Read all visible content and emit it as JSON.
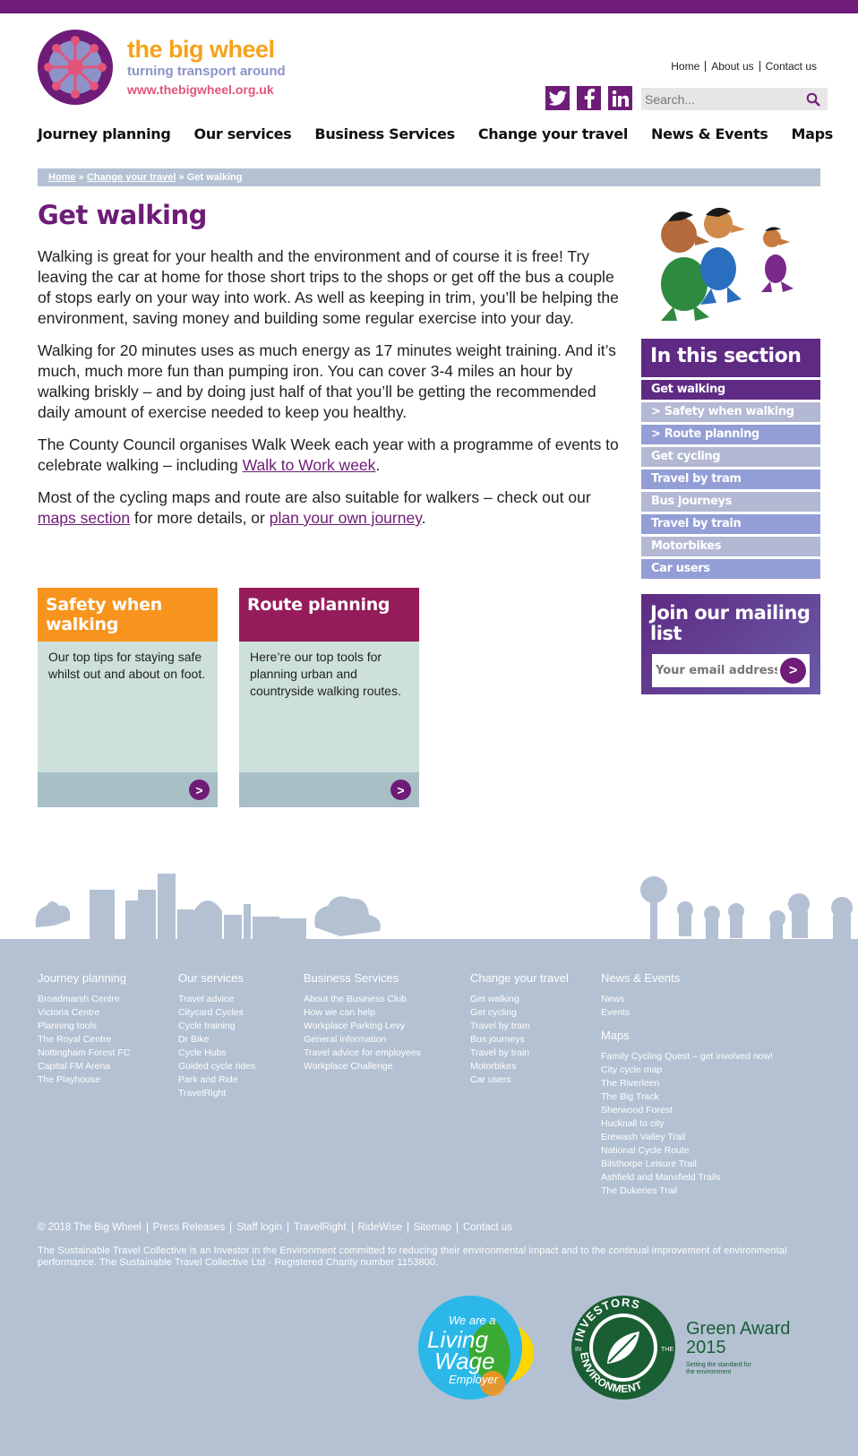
{
  "logo": {
    "title": "the big wheel",
    "subtitle": "turning transport around",
    "url": "www.thebigwheel.org.uk"
  },
  "toplinks": [
    "Home",
    "About us",
    "Contact us"
  ],
  "social": [
    {
      "icon": "twitter-icon",
      "glyph": "t"
    },
    {
      "icon": "facebook-icon",
      "glyph": "f"
    },
    {
      "icon": "linkedin-icon",
      "glyph": "in"
    }
  ],
  "search": {
    "placeholder": "Search..."
  },
  "nav": [
    "Journey planning",
    "Our services",
    "Business Services",
    "Change your travel",
    "News & Events",
    "Maps"
  ],
  "breadcrumb": {
    "home": "Home",
    "sep": "»",
    "parent": "Change your travel",
    "current": "Get walking"
  },
  "main": {
    "title": "Get walking",
    "p1": "Walking is great for your health and the environment and of course it is free!  Try leaving the car at home for those short trips to the shops or get off the bus a couple of stops early on your way into work. As well as keeping in trim, you’ll be helping the environment, saving money and building some regular exercise into your day.",
    "p2": "Walking for 20 minutes  uses as much energy as 17 minutes  weight training. And it’s much, much  more fun than pumping iron. You can  cover 3-4 miles an hour by walking  briskly – and by doing just half of that  you’ll be getting the recommended  daily amount of exercise needed to  keep you healthy.",
    "p3_before": "The County Council organises Walk Week each year with a programme of events to celebrate walking – including ",
    "p3_link": "Walk to Work week",
    "p3_after": ".",
    "p4_before": "Most of the cycling maps and route are also suitable for walkers – check out our ",
    "p4_link1": "maps section",
    "p4_mid": " for more details, or ",
    "p4_link2": "plan your own journey",
    "p4_after": "."
  },
  "cards": [
    {
      "title": "Safety when walking",
      "text": "Our top tips for staying safe whilst out and about on foot.",
      "color": "#f7941e",
      "arrow": ">"
    },
    {
      "title": "Route planning",
      "text": "Here’re our top tools for planning urban and countryside walking routes.",
      "color": "#951b5b",
      "arrow": ">"
    }
  ],
  "sidebar": {
    "heading": "In this section",
    "items": [
      {
        "label": "Get walking"
      },
      {
        "label": "> Safety when walking"
      },
      {
        "label": "> Route planning"
      },
      {
        "label": "Get cycling"
      },
      {
        "label": "Travel by tram"
      },
      {
        "label": "Bus journeys"
      },
      {
        "label": "Travel by train"
      },
      {
        "label": "Motorbikes"
      },
      {
        "label": "Car users"
      }
    ]
  },
  "mailing": {
    "title": "Join our mailing list",
    "placeholder": "Your email address",
    "go": ">"
  },
  "footer": {
    "columns": [
      {
        "heading": "Journey planning",
        "links": [
          "Broadmarsh Centre",
          "Victoria Centre",
          "Planning tools",
          "The Royal Centre",
          "Nottingham Forest FC",
          "Capital FM Arena",
          "The Playhouse"
        ]
      },
      {
        "heading": "Our services",
        "links": [
          "Travel advice",
          "Citycard Cycles",
          "Cycle training",
          "Dr Bike",
          "Cycle Hubs",
          "Guided cycle rides",
          "Park and Ride",
          "TravelRight"
        ]
      },
      {
        "heading": "Business Services",
        "links": [
          "About the Business Club",
          "How we can help",
          "Workplace Parking Levy",
          "General information",
          "Travel advice for employees",
          "Workplace Challenge"
        ]
      },
      {
        "heading": "Change your travel",
        "links": [
          "Get walking",
          "Get cycling",
          "Travel by tram",
          "Bus journeys",
          "Travel by train",
          "Motorbikes",
          "Car users"
        ]
      },
      {
        "heading": "News & Events",
        "links": [
          "News",
          "Events"
        ],
        "subheading": "Maps",
        "sublinks": [
          "Family Cycling Quest – get involved now!",
          "City cycle map",
          "The Riverleen",
          "The Big Track",
          "Sherwood Forest",
          "Hucknall to city",
          "Erewash Valley Trail",
          "National Cycle Route",
          "Bilsthorpe Leisure Trail",
          "Ashfield and Mansfield Trails",
          "The Dukeries Trail"
        ]
      }
    ],
    "bottom_links": [
      "© 2018 The Big Wheel",
      "Press Releases",
      "Staff login",
      "TravelRight",
      "RideWise",
      "Sitemap",
      "Contact us"
    ],
    "charity": "The Sustainable Travel Collective is an Investor in the Environment committed to reducing their environmental impact and to the continual improvement of environmental performance. The Sustainable Travel Collective Ltd - Registered Charity number 1153800.",
    "badge_lw": {
      "line1": "We are a",
      "line2": "Living",
      "line3": "Wage",
      "line4": "Employer"
    },
    "badge_ie": {
      "ring_top": "INVESTORS",
      "ring_bottom": "ENVIRONMENT",
      "in": "IN",
      "the": "THE",
      "award": "Green Award",
      "year": "2015",
      "tagline1": "Setting the standard for",
      "tagline2": "the environment"
    }
  }
}
